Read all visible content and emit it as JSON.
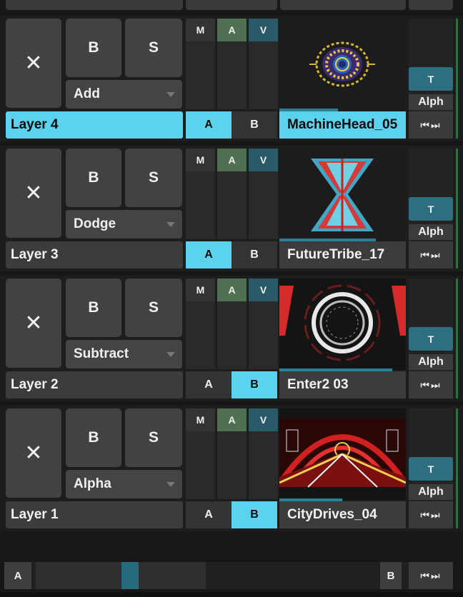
{
  "layers": [
    {
      "name": "Layer 4",
      "blend": "Add",
      "clip": "MachineHead_05",
      "ab_on": "A",
      "active": true
    },
    {
      "name": "Layer 3",
      "blend": "Dodge",
      "clip": "FutureTribe_17",
      "ab_on": "A",
      "active": false
    },
    {
      "name": "Layer 2",
      "blend": "Subtract",
      "clip": "Enter2 03",
      "ab_on": "B",
      "active": false
    },
    {
      "name": "Layer 1",
      "blend": "Alpha",
      "clip": "CityDrives_04",
      "ab_on": "B",
      "active": false
    }
  ],
  "labels": {
    "close": "✕",
    "bypass": "B",
    "solo": "S",
    "m": "M",
    "a_tag": "A",
    "v": "V",
    "a": "A",
    "b": "B",
    "t": "T",
    "alph": "Alph",
    "nav": "⏮⏭"
  },
  "crossfader": {
    "left_label": "A",
    "right_label": "B",
    "nav": "⏮⏭"
  },
  "colors": {
    "accent": "#5bd3ee",
    "audio_green": "#4f7152",
    "video_teal": "#2a5a67",
    "progress": "#2b7f97"
  }
}
